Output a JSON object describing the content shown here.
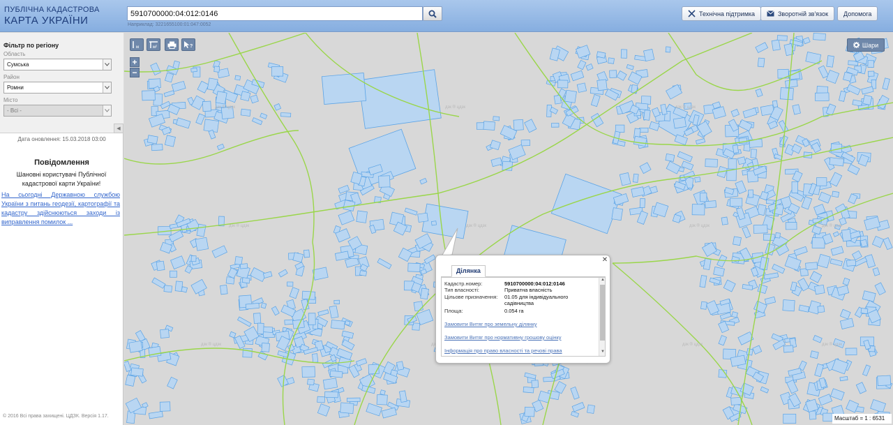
{
  "header": {
    "logo_line1": "ПУБЛІЧНА КАДАСТРОВА",
    "logo_line2": "КАРТА УКРАЇНИ",
    "search_value": "5910700000:04:012:0146",
    "search_hint": "Наприклад: 3221655100:01:047:0052",
    "support_label": "Технічна підтримка",
    "feedback_label": "Зворотній зв'язок",
    "help_label": "Допомога"
  },
  "sidebar": {
    "filter_title": "Фільтр по регіону",
    "region_label": "Область",
    "region_value": "Сумська",
    "district_label": "Район",
    "district_value": "Ромни",
    "city_label": "Місто",
    "city_value": "- Всі -",
    "update_text": "Дата оновлення: 15.03.2018 03:00",
    "news_title": "Повідомлення",
    "news_text": "Шановні користувачі Публічної кадастрової карти України!",
    "news_link": "На сьогодні Державною службою України з питань геодезії, картографії та кадастру здійснюються заходи із виправлення помилок ...",
    "copyright": "© 2016 Всі права захищені. ЦДЗК. Версія 1.17."
  },
  "map": {
    "layers_label": "Шари",
    "scale_text": "Масштаб = 1 : 6531",
    "watermark": "дзк ® цдзк"
  },
  "popup": {
    "tab_label": "Ділянка",
    "cadastre_label": "Кадастр.номер:",
    "cadastre_value": "5910700000:04:012:0146",
    "ownership_label": "Тип власності:",
    "ownership_value": "Приватна власність",
    "purpose_label": "Цільове призначення:",
    "purpose_value": "01.05 для індивідуального садівництва",
    "area_label": "Площа:",
    "area_value": "0.054 га",
    "link1": "Замовити Витяг про земельну ділянку",
    "link2": "Замовити Витяг про нормативну грошову оцінку",
    "link3": "Інформація про право власності та речові права"
  },
  "colors": {
    "parcel_fill": "#b9d6f2",
    "parcel_stroke": "#5aa3e6",
    "boundary": "#9ad64a",
    "header": "#93b6e5",
    "tool_button": "#6f88aa"
  }
}
